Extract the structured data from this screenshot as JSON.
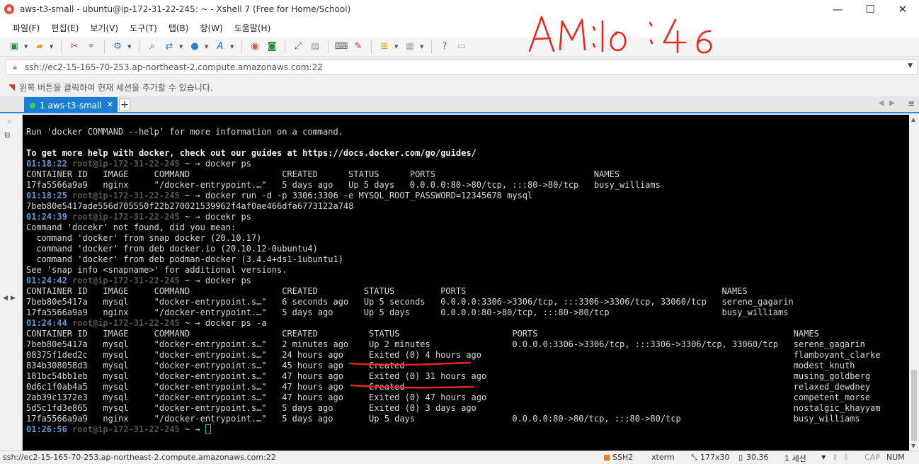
{
  "window": {
    "title": "aws-t3-small - ubuntu@ip-172-31-22-245: ~ - Xshell 7 (Free for Home/School)",
    "minimize": "—",
    "maximize": "☐",
    "close": "✕"
  },
  "menu": {
    "items": [
      "파일(F)",
      "편집(E)",
      "보기(V)",
      "도구(T)",
      "탭(B)",
      "창(W)",
      "도움말(H)"
    ]
  },
  "address": {
    "value": "ssh://ec2-15-165-70-253.ap-northeast-2.compute.amazonaws.com:22"
  },
  "hint": {
    "text": "왼쪽 버튼을 클릭하여 현재 세션을 추가할 수 있습니다."
  },
  "tabs": [
    {
      "label": "1 aws-t3-small",
      "active": true
    }
  ],
  "terminal": {
    "lines": [
      {
        "text": "Run 'docker COMMAND --help' for more information on a command."
      },
      {
        "text": ""
      },
      {
        "text": "To get more help with docker, check out our guides at https://docs.docker.com/go/guides/",
        "bold": true
      },
      {
        "time": "01:18:22",
        "user": "root@ip-172-31-22-245",
        "cmd": "docker ps"
      },
      {
        "text": "CONTAINER ID   IMAGE     COMMAND                  CREATED      STATUS      PORTS                               NAMES"
      },
      {
        "text": "17fa5566a9a9   nginx     \"/docker-entrypoint.…\"   5 days ago   Up 5 days   0.0.0.0:80->80/tcp, :::80->80/tcp   busy_williams"
      },
      {
        "time": "01:18:25",
        "user": "root@ip-172-31-22-245",
        "cmd": "docker run -d -p 3306:3306 -e MYSQL_ROOT_PASSWORD=12345678 mysql"
      },
      {
        "text": "7beb80e5417ade556d705550f22b270021539962f4af0ae466dfa6773122a748"
      },
      {
        "time": "01:24:39",
        "user": "root@ip-172-31-22-245",
        "cmd": "docekr ps"
      },
      {
        "text": "Command 'docekr' not found, did you mean:"
      },
      {
        "text": "  command 'docker' from snap docker (20.10.17)"
      },
      {
        "text": "  command 'docker' from deb docker.io (20.10.12-0ubuntu4)"
      },
      {
        "text": "  command 'docker' from deb podman-docker (3.4.4+ds1-1ubuntu1)"
      },
      {
        "text": "See 'snap info <snapname>' for additional versions."
      },
      {
        "time": "01:24:42",
        "user": "root@ip-172-31-22-245",
        "cmd": "docker ps"
      },
      {
        "text": "CONTAINER ID   IMAGE     COMMAND                  CREATED         STATUS         PORTS                                                  NAMES"
      },
      {
        "text": "7beb80e5417a   mysql     \"docker-entrypoint.s…\"   6 seconds ago   Up 5 seconds   0.0.0.0:3306->3306/tcp, :::3306->3306/tcp, 33060/tcp   serene_gagarin"
      },
      {
        "text": "17fa5566a9a9   nginx     \"/docker-entrypoint.…\"   5 days ago      Up 5 days      0.0.0.0:80->80/tcp, :::80->80/tcp                      busy_williams"
      },
      {
        "time": "01:24:44",
        "user": "root@ip-172-31-22-245",
        "cmd": "docker ps -a"
      },
      {
        "text": "CONTAINER ID   IMAGE     COMMAND                  CREATED          STATUS                      PORTS                                                  NAMES"
      },
      {
        "text": "7beb80e5417a   mysql     \"docker-entrypoint.s…\"   2 minutes ago    Up 2 minutes                0.0.0.0:3306->3306/tcp, :::3306->3306/tcp, 33060/tcp   serene_gagarin"
      },
      {
        "text": "08375f1ded2c   mysql     \"docker-entrypoint.s…\"   24 hours ago     Exited (0) 4 hours ago                                                             flamboyant_clarke"
      },
      {
        "text": "834b308058d3   mysql     \"docker-entrypoint.s…\"   45 hours ago     Created                                                                            modest_knuth"
      },
      {
        "text": "181bc54bb1eb   mysql     \"docker-entrypoint.s…\"   47 hours ago     Exited (0) 31 hours ago                                                            musing_goldberg"
      },
      {
        "text": "0d6c1f0ab4a5   mysql     \"docker-entrypoint.s…\"   47 hours ago     Created                                                                            relaxed_dewdney"
      },
      {
        "text": "2ab39c1372e3   mysql     \"docker-entrypoint.s…\"   47 hours ago     Exited (0) 47 hours ago                                                            competent_morse"
      },
      {
        "text": "5d5c1fd3e865   mysql     \"docker-entrypoint.s…\"   5 days ago       Exited (0) 3 days ago                                                              nostalgic_khayyam"
      },
      {
        "text": "17fa5566a9a9   nginx     \"/docker-entrypoint.…\"   5 days ago       Up 5 days                   0.0.0.0:80->80/tcp, :::80->80/tcp                      busy_williams"
      },
      {
        "time": "01:26:56",
        "user": "root@ip-172-31-22-245",
        "cmd": "",
        "cursor": true
      }
    ],
    "prompt_arrow": "~ → "
  },
  "statusbar": {
    "path": "ssh://ec2-15-165-70-253.ap-northeast-2.compute.amazonaws.com:22",
    "protocol": "SSH2",
    "term": "xterm",
    "size": "177x30",
    "position": "30,36",
    "sessions": "1 세션",
    "caps": "CAP",
    "num": "NUM"
  },
  "annotation": {
    "handwritten_time": "AM 10:46",
    "color": "#e8261f"
  }
}
